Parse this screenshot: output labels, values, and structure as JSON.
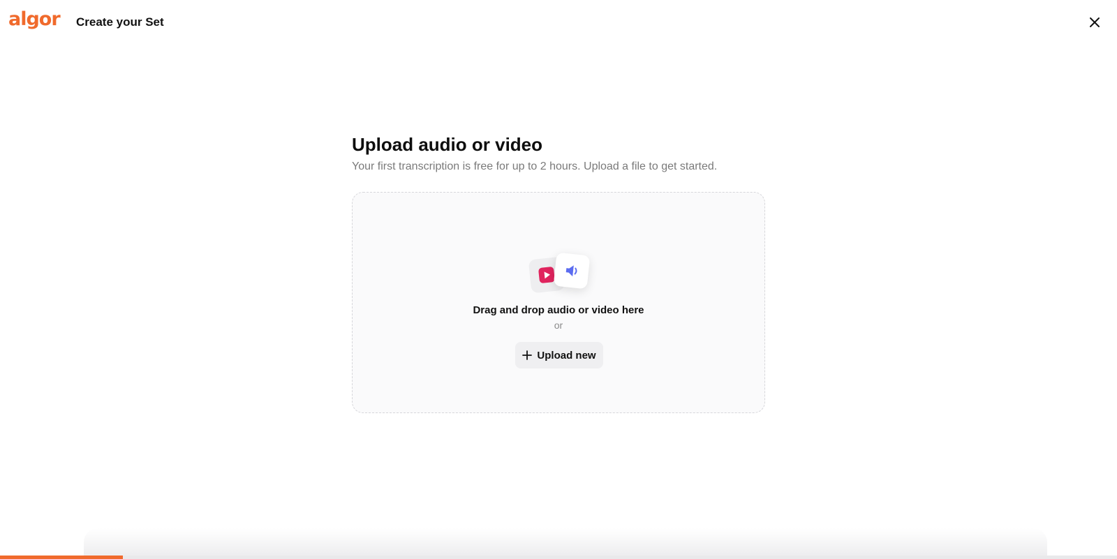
{
  "header": {
    "logo_text": "algor",
    "title": "Create your Set",
    "close_icon": "close-icon"
  },
  "main": {
    "heading": "Upload audio or video",
    "subheading": "Your first transcription is free for up to 2 hours. Upload a file to get started."
  },
  "dropzone": {
    "icons": [
      "video-play-icon",
      "speaker-icon"
    ],
    "drag_text": "Drag and drop audio or video here",
    "or_text": "or",
    "upload_button_label": "Upload new",
    "upload_button_icon": "plus-icon"
  },
  "progress": {
    "fraction": 0.11
  },
  "colors": {
    "brand": "#f06a2c",
    "video_icon": "#e0245e",
    "audio_icon": "#5b6cf0"
  }
}
